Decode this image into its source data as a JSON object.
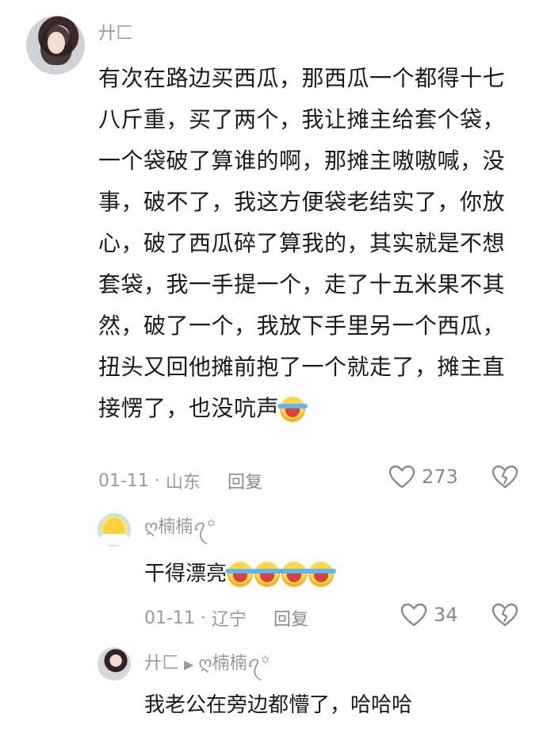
{
  "comment": {
    "username": "廾匚",
    "text": "有次在路边买西瓜，那西瓜一个都得十七八斤重，买了两个，我让摊主给套个袋，一个袋破了算谁的啊，那摊主嗷嗷喊，没事，破不了，我这方便袋老结实了，你放心，破了西瓜碎了算我的，其实就是不想套袋，我一手提一个，走了十五米果不其然，破了一个，我放下手里另一个西瓜，扭头又回他摊前抱了一个就走了，摊主直接愣了，也没吭声",
    "date": "01-11",
    "location": "山东",
    "reply_label": "回复",
    "likes": "273",
    "emoji_icon": "rofl-crying-laughing-emoji"
  },
  "reply1": {
    "username": "ღ楠楠ꪖ꙳",
    "text": "干得漂亮",
    "emoji_icon": "rofl-crying-laughing-emoji",
    "date": "01-11",
    "location": "辽宁",
    "reply_label": "回复",
    "likes": "34"
  },
  "reply2": {
    "username": "廾匚",
    "reply_to": "ღ楠楠ꪖ꙳",
    "text": "我老公在旁边都懵了，哈哈哈"
  },
  "colors": {
    "text": "#1a1a1a",
    "meta": "#9a9a9a",
    "background": "#ffffff"
  }
}
